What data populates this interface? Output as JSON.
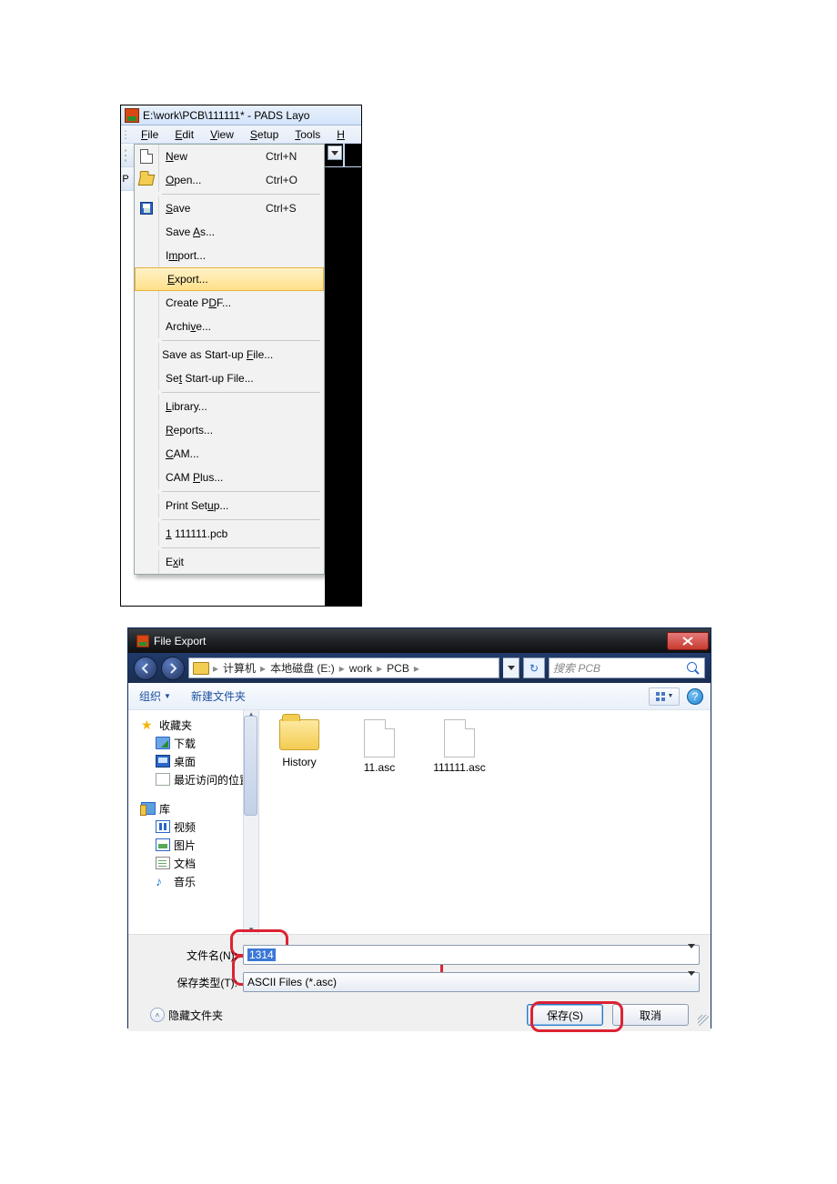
{
  "app": {
    "title": "E:\\work\\PCB\\111111* - PADS Layo",
    "menus": {
      "file": "File",
      "edit": "Edit",
      "view": "View",
      "setup": "Setup",
      "tools": "Tools",
      "help": "H"
    },
    "side_letter": "P"
  },
  "file_menu": {
    "new": {
      "label": "New",
      "shortcut": "Ctrl+N"
    },
    "open": {
      "label": "Open...",
      "shortcut": "Ctrl+O"
    },
    "save": {
      "label": "Save",
      "shortcut": "Ctrl+S"
    },
    "saveas": {
      "label": "Save As..."
    },
    "import": {
      "label": "Import..."
    },
    "export": {
      "label": "Export..."
    },
    "pdf": {
      "label": "Create PDF..."
    },
    "archive": {
      "label": "Archive..."
    },
    "savesu": {
      "label": "Save as Start-up File..."
    },
    "setsu": {
      "label": "Set Start-up File..."
    },
    "library": {
      "label": "Library..."
    },
    "reports": {
      "label": "Reports..."
    },
    "cam": {
      "label": "CAM..."
    },
    "camplus": {
      "label": "CAM Plus..."
    },
    "printsu": {
      "label": "Print Setup..."
    },
    "recent1": {
      "label": "1 111111.pcb"
    },
    "exit": {
      "label": "Exit"
    }
  },
  "dialog": {
    "title": "File Export",
    "breadcrumb": {
      "c0": "计算机",
      "c1": "本地磁盘 (E:)",
      "c2": "work",
      "c3": "PCB"
    },
    "search_placeholder": "搜索 PCB",
    "organize": "组织",
    "new_folder": "新建文件夹",
    "tree": {
      "fav": "收藏夹",
      "dl": "下载",
      "desk": "桌面",
      "recent": "最近访问的位置",
      "libs": "库",
      "vid": "视频",
      "pic": "图片",
      "doc": "文档",
      "mus": "音乐"
    },
    "files": {
      "f0": "History",
      "f1": "11.asc",
      "f2": "111111.asc"
    },
    "filename_label": "文件名(N):",
    "filetype_label": "保存类型(T):",
    "filename_value": "1314",
    "filetype_value": "ASCII Files (*.asc)",
    "hide_folders": "隐藏文件夹",
    "save": "保存(S)",
    "cancel": "取消"
  }
}
